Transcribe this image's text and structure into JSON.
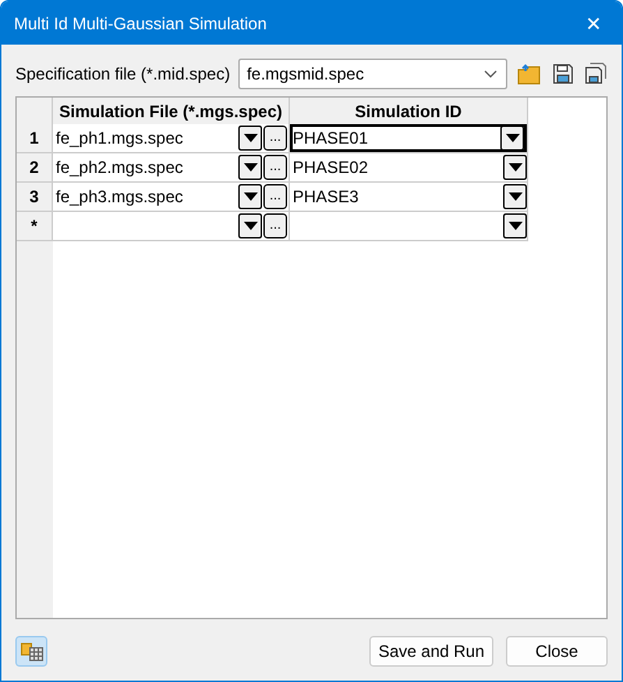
{
  "window": {
    "title": "Multi Id Multi-Gaussian Simulation",
    "close": "✕"
  },
  "spec_file": {
    "label": "Specification file (*.mid.spec)",
    "value": "fe.mgsmid.spec"
  },
  "table": {
    "columns": [
      "Simulation File (*.mgs.spec)",
      "Simulation ID"
    ],
    "rows": [
      {
        "header": "1",
        "file": "fe_ph1.mgs.spec",
        "browse": "...",
        "sim_id": "PHASE01",
        "selected": true
      },
      {
        "header": "2",
        "file": "fe_ph2.mgs.spec",
        "browse": "...",
        "sim_id": "PHASE02",
        "selected": false
      },
      {
        "header": "3",
        "file": "fe_ph3.mgs.spec",
        "browse": "...",
        "sim_id": "PHASE3",
        "selected": false
      },
      {
        "header": "*",
        "file": "",
        "browse": "...",
        "sim_id": "",
        "selected": false
      }
    ]
  },
  "buttons": [
    "Save and Run",
    "Close"
  ]
}
